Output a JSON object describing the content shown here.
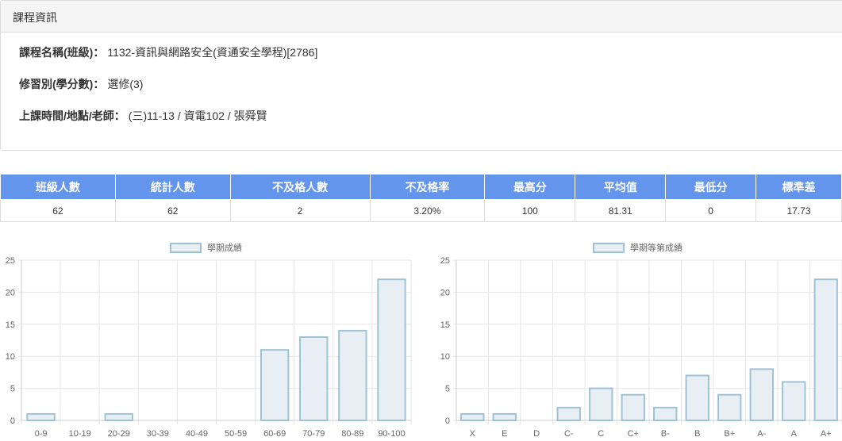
{
  "panel": {
    "title": "課程資訊",
    "rows": [
      {
        "label": "課程名稱(班級)：",
        "value": "1132-資訊與網路安全(資通安全學程)[2786]"
      },
      {
        "label": "修習別(學分數)：",
        "value": "選修(3)"
      },
      {
        "label": "上課時間/地點/老師：",
        "value": "(三)11-13 / 資電102 / 張舜賢"
      }
    ]
  },
  "stats": {
    "headers": [
      "班級人數",
      "統計人數",
      "不及格人數",
      "不及格率",
      "最高分",
      "平均值",
      "最低分",
      "標準差"
    ],
    "values": [
      "62",
      "62",
      "2",
      "3.20%",
      "100",
      "81.31",
      "0",
      "17.73"
    ]
  },
  "colors": {
    "header_bg": "#6495ed",
    "bar_fill": "#e8eff4",
    "bar_stroke": "#9fc2d4",
    "grid": "#e6e6e6"
  },
  "chart_data": [
    {
      "type": "bar",
      "legend": "學期成績",
      "categories": [
        "0-9",
        "10-19",
        "20-29",
        "30-39",
        "40-49",
        "50-59",
        "60-69",
        "70-79",
        "80-89",
        "90-100"
      ],
      "values": [
        1,
        0,
        1,
        0,
        0,
        0,
        11,
        13,
        14,
        22
      ],
      "ylim": [
        0,
        25
      ],
      "yticks": [
        "0",
        "5",
        "10",
        "15",
        "20",
        "25"
      ],
      "legend_position": "top"
    },
    {
      "type": "bar",
      "legend": "學期等第成績",
      "categories": [
        "X",
        "E",
        "D",
        "C-",
        "C",
        "C+",
        "B-",
        "B",
        "B+",
        "A-",
        "A",
        "A+"
      ],
      "values": [
        1,
        1,
        0,
        2,
        5,
        4,
        2,
        7,
        4,
        8,
        6,
        22
      ],
      "ylim": [
        0,
        25
      ],
      "yticks": [
        "0",
        "5",
        "10",
        "15",
        "20",
        "25"
      ],
      "legend_position": "top"
    }
  ]
}
